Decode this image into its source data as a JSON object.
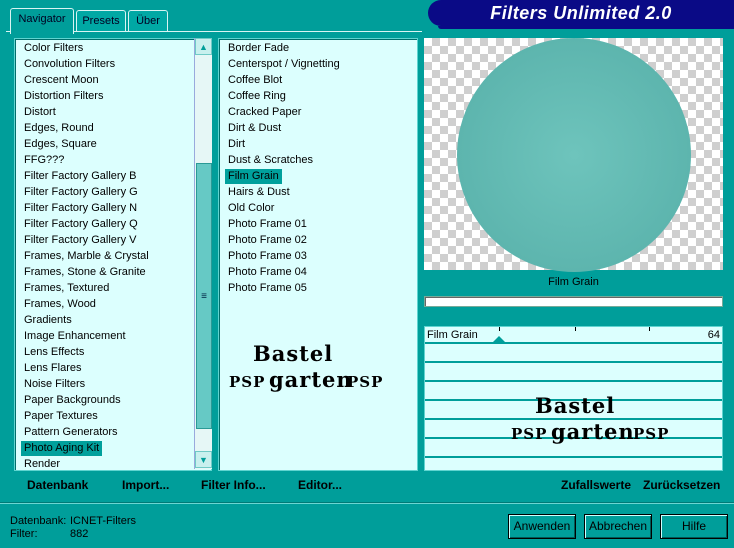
{
  "tabs": [
    {
      "label": "Navigator",
      "active": true
    },
    {
      "label": "Presets",
      "active": false
    },
    {
      "label": "Über",
      "active": false
    }
  ],
  "app_title": "Filters Unlimited 2.0",
  "categories": [
    "Color Filters",
    "Convolution Filters",
    "Crescent Moon",
    "Distortion Filters",
    "Distort",
    "Edges, Round",
    "Edges, Square",
    "FFG???",
    "Filter Factory Gallery B",
    "Filter Factory Gallery G",
    "Filter Factory Gallery N",
    "Filter Factory Gallery Q",
    "Filter Factory Gallery V",
    "Frames, Marble & Crystal",
    "Frames, Stone & Granite",
    "Frames, Textured",
    "Frames, Wood",
    "Gradients",
    "Image Enhancement",
    "Lens Effects",
    "Lens Flares",
    "Noise Filters",
    "Paper Backgrounds",
    "Paper Textures",
    "Pattern Generators",
    "Photo Aging Kit",
    "Render"
  ],
  "selected_category": "Photo Aging Kit",
  "filters": [
    "Border Fade",
    "Centerspot / Vignetting",
    "Coffee Blot",
    "Coffee Ring",
    "Cracked Paper",
    "Dirt & Dust",
    "Dirt",
    "Dust & Scratches",
    "Film Grain",
    "Hairs & Dust",
    "Old Color",
    "Photo Frame 01",
    "Photo Frame 02",
    "Photo Frame 03",
    "Photo Frame 04",
    "Photo Frame 05"
  ],
  "selected_filter": "Film Grain",
  "preview": {
    "label": "Film Grain"
  },
  "progress": {
    "value": 0
  },
  "sliders": [
    {
      "name": "Film Grain",
      "value": "64",
      "fraction": 0.25
    }
  ],
  "watermark": {
    "line1": "Bastel",
    "line2": "garten",
    "side": "PSP"
  },
  "links": {
    "database": "Datenbank",
    "import": "Import...",
    "filter_info": "Filter Info...",
    "editor": "Editor...",
    "random": "Zufallswerte",
    "reset": "Zurücksetzen"
  },
  "status": {
    "database_label": "Datenbank:",
    "database_value": "ICNET-Filters",
    "filter_label": "Filter:",
    "filter_value": "882"
  },
  "buttons": {
    "apply": "Anwenden",
    "cancel": "Abbrechen",
    "help": "Hilfe"
  },
  "colors": {
    "background": "#009e9a",
    "panel": "#dcfffe",
    "title_banner": "#0a0a86",
    "selection": "#00a09c"
  }
}
